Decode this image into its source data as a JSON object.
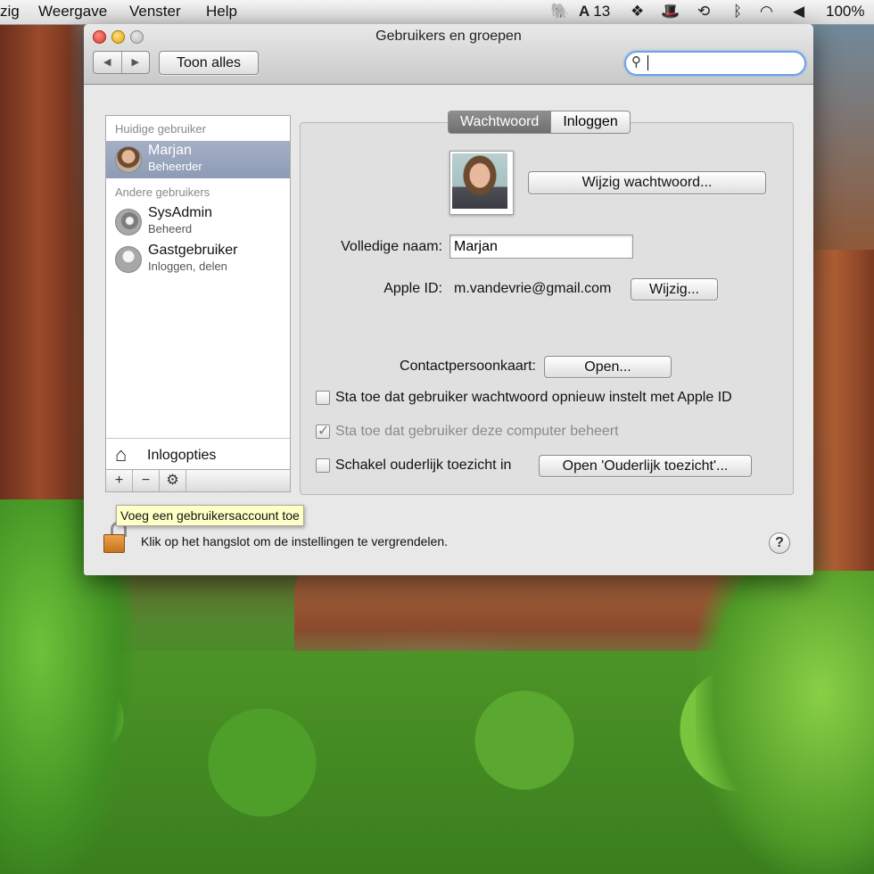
{
  "menubar": {
    "items": [
      "zig",
      "Weergave",
      "Venster",
      "Help"
    ],
    "status": {
      "evernote_icon": "elephant-icon",
      "adobe_count": "13",
      "dropbox_icon": "dropbox-icon",
      "hat_icon": "hat-icon",
      "timemachine_icon": "clock-icon",
      "bluetooth_icon": "bluetooth-icon",
      "wifi_icon": "wifi-icon",
      "volume_icon": "speaker-icon",
      "battery": "100%"
    }
  },
  "window": {
    "title": "Gebruikers en groepen",
    "toolbar": {
      "show_all": "Toon alles",
      "search_value": ""
    },
    "sidebar": {
      "current_header": "Huidige gebruiker",
      "other_header": "Andere gebruikers",
      "users": [
        {
          "name": "Marjan",
          "role": "Beheerder"
        },
        {
          "name": "SysAdmin",
          "role": "Beheerd"
        },
        {
          "name": "Gastgebruiker",
          "role": "Inloggen, delen"
        }
      ],
      "login_options": "Inlogopties",
      "toolbar": {
        "add": "+",
        "remove": "−",
        "gear": "⚙"
      }
    },
    "tabs": [
      "Wachtwoord",
      "Inloggen"
    ],
    "detail": {
      "change_password": "Wijzig wachtwoord...",
      "full_name_label": "Volledige naam:",
      "full_name_value": "Marjan",
      "apple_id_label": "Apple ID:",
      "apple_id_value": "m.vandevrie@gmail.com",
      "apple_id_change": "Wijzig...",
      "contact_label": "Contactpersoonkaart:",
      "contact_open": "Open...",
      "checkbox_reset": "Sta toe dat gebruiker wachtwoord opnieuw instelt met Apple ID",
      "checkbox_admin": "Sta toe dat gebruiker deze computer beheert",
      "checkbox_parental": "Schakel ouderlijk toezicht in",
      "parental_open": "Open 'Ouderlijk toezicht'..."
    },
    "tooltip": "Voeg een gebruikersaccount toe",
    "lock_text": "Klik op het hangslot om de instellingen te vergrendelen.",
    "help": "?"
  }
}
